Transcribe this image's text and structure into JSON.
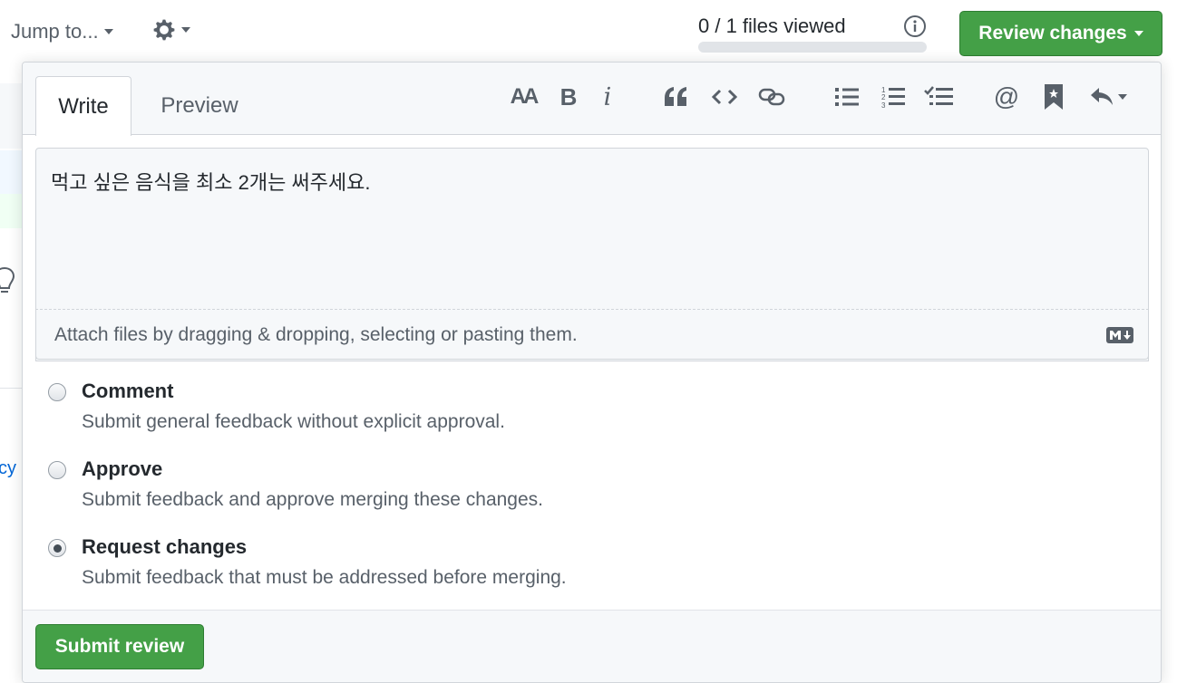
{
  "topbar": {
    "jump_label": "Jump to...",
    "files_viewed": "0 / 1 files viewed",
    "files_viewed_progress": 0,
    "review_button": "Review changes"
  },
  "left_fragment": {
    "link_text": "cy"
  },
  "editor": {
    "tabs": [
      {
        "label": "Write",
        "active": true
      },
      {
        "label": "Preview",
        "active": false
      }
    ],
    "toolbar": [
      "heading-icon",
      "bold-icon",
      "italic-icon",
      "quote-icon",
      "code-icon",
      "link-icon",
      "bulleted-list-icon",
      "numbered-list-icon",
      "task-list-icon",
      "mention-icon",
      "reference-icon",
      "saved-replies-icon"
    ],
    "bold_glyph": "B",
    "italic_glyph": "i",
    "heading_glyph": "AA",
    "mention_glyph": "@",
    "value": "먹고 싶은 음식을 최소 2개는 써주세요.",
    "attach_text": "Attach files by dragging & dropping, selecting or pasting them."
  },
  "options": [
    {
      "title": "Comment",
      "description": "Submit general feedback without explicit approval.",
      "checked": false
    },
    {
      "title": "Approve",
      "description": "Submit feedback and approve merging these changes.",
      "checked": false
    },
    {
      "title": "Request changes",
      "description": "Submit feedback that must be addressed before merging.",
      "checked": true
    }
  ],
  "submit_button": "Submit review",
  "colors": {
    "accent_green": "#44a047",
    "muted_text": "#586069",
    "link_blue": "#0366d6"
  }
}
